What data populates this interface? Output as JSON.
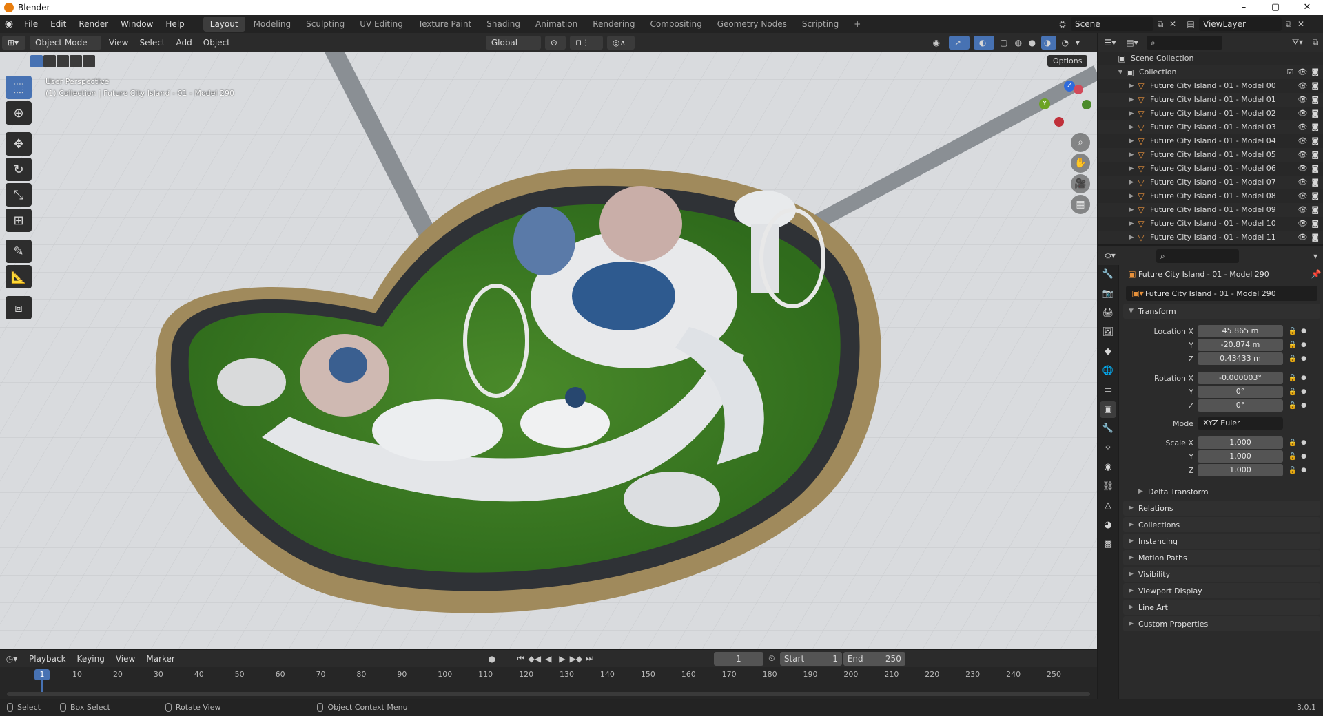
{
  "app": {
    "window_title": "Blender",
    "window_controls": [
      "–",
      "▢",
      "✕"
    ]
  },
  "menu": {
    "items": [
      "File",
      "Edit",
      "Render",
      "Window",
      "Help"
    ]
  },
  "workspaces": {
    "tabs": [
      "Layout",
      "Modeling",
      "Sculpting",
      "UV Editing",
      "Texture Paint",
      "Shading",
      "Animation",
      "Rendering",
      "Compositing",
      "Geometry Nodes",
      "Scripting"
    ],
    "active": "Layout",
    "add": "+"
  },
  "scene": {
    "label": "Scene",
    "view_layer": "ViewLayer"
  },
  "viewport_header": {
    "mode": "Object Mode",
    "menus": [
      "View",
      "Select",
      "Add",
      "Object"
    ],
    "transform_orientation": "Global",
    "options": "Options"
  },
  "viewport": {
    "perspective": "User Perspective",
    "collection_info": "(1) Collection | Future City Island - 01 - Model 290",
    "gizmo_axes": [
      "Z",
      "Y"
    ]
  },
  "outliner": {
    "scene_collection": "Scene Collection",
    "collection": "Collection",
    "items": [
      "Future City Island - 01 - Model 00",
      "Future City Island - 01 - Model 01",
      "Future City Island - 01 - Model 02",
      "Future City Island - 01 - Model 03",
      "Future City Island - 01 - Model 04",
      "Future City Island - 01 - Model 05",
      "Future City Island - 01 - Model 06",
      "Future City Island - 01 - Model 07",
      "Future City Island - 01 - Model 08",
      "Future City Island - 01 - Model 09",
      "Future City Island - 01 - Model 10",
      "Future City Island - 01 - Model 11"
    ]
  },
  "properties": {
    "object_title": "Future City Island - 01 - Model 290",
    "object_name": "Future City Island - 01 - Model 290",
    "transform": {
      "header": "Transform",
      "location": {
        "label": "Location X",
        "x": "45.865 m",
        "y": "-20.874 m",
        "z": "0.43433 m"
      },
      "rotation": {
        "label": "Rotation X",
        "x": "-0.000003°",
        "y": "0°",
        "z": "0°"
      },
      "mode_label": "Mode",
      "mode": "XYZ Euler",
      "scale": {
        "label": "Scale X",
        "x": "1.000",
        "y": "1.000",
        "z": "1.000"
      },
      "axis_y": "Y",
      "axis_z": "Z"
    },
    "delta_transform": "Delta Transform",
    "panels": [
      "Relations",
      "Collections",
      "Instancing",
      "Motion Paths",
      "Visibility",
      "Viewport Display",
      "Line Art",
      "Custom Properties"
    ]
  },
  "timeline": {
    "menus": [
      "Playback",
      "Keying",
      "View",
      "Marker"
    ],
    "current_frame": "1",
    "start_label": "Start",
    "start": "1",
    "end_label": "End",
    "end": "250",
    "ticks": [
      "10",
      "20",
      "30",
      "40",
      "50",
      "60",
      "70",
      "80",
      "90",
      "100",
      "110",
      "120",
      "130",
      "140",
      "150",
      "160",
      "170",
      "180",
      "190",
      "200",
      "210",
      "220",
      "230",
      "240",
      "250"
    ],
    "playhead": "1"
  },
  "statusbar": {
    "items": [
      "Select",
      "Box Select",
      "Rotate View",
      "Object Context Menu"
    ],
    "version": "3.0.1"
  }
}
